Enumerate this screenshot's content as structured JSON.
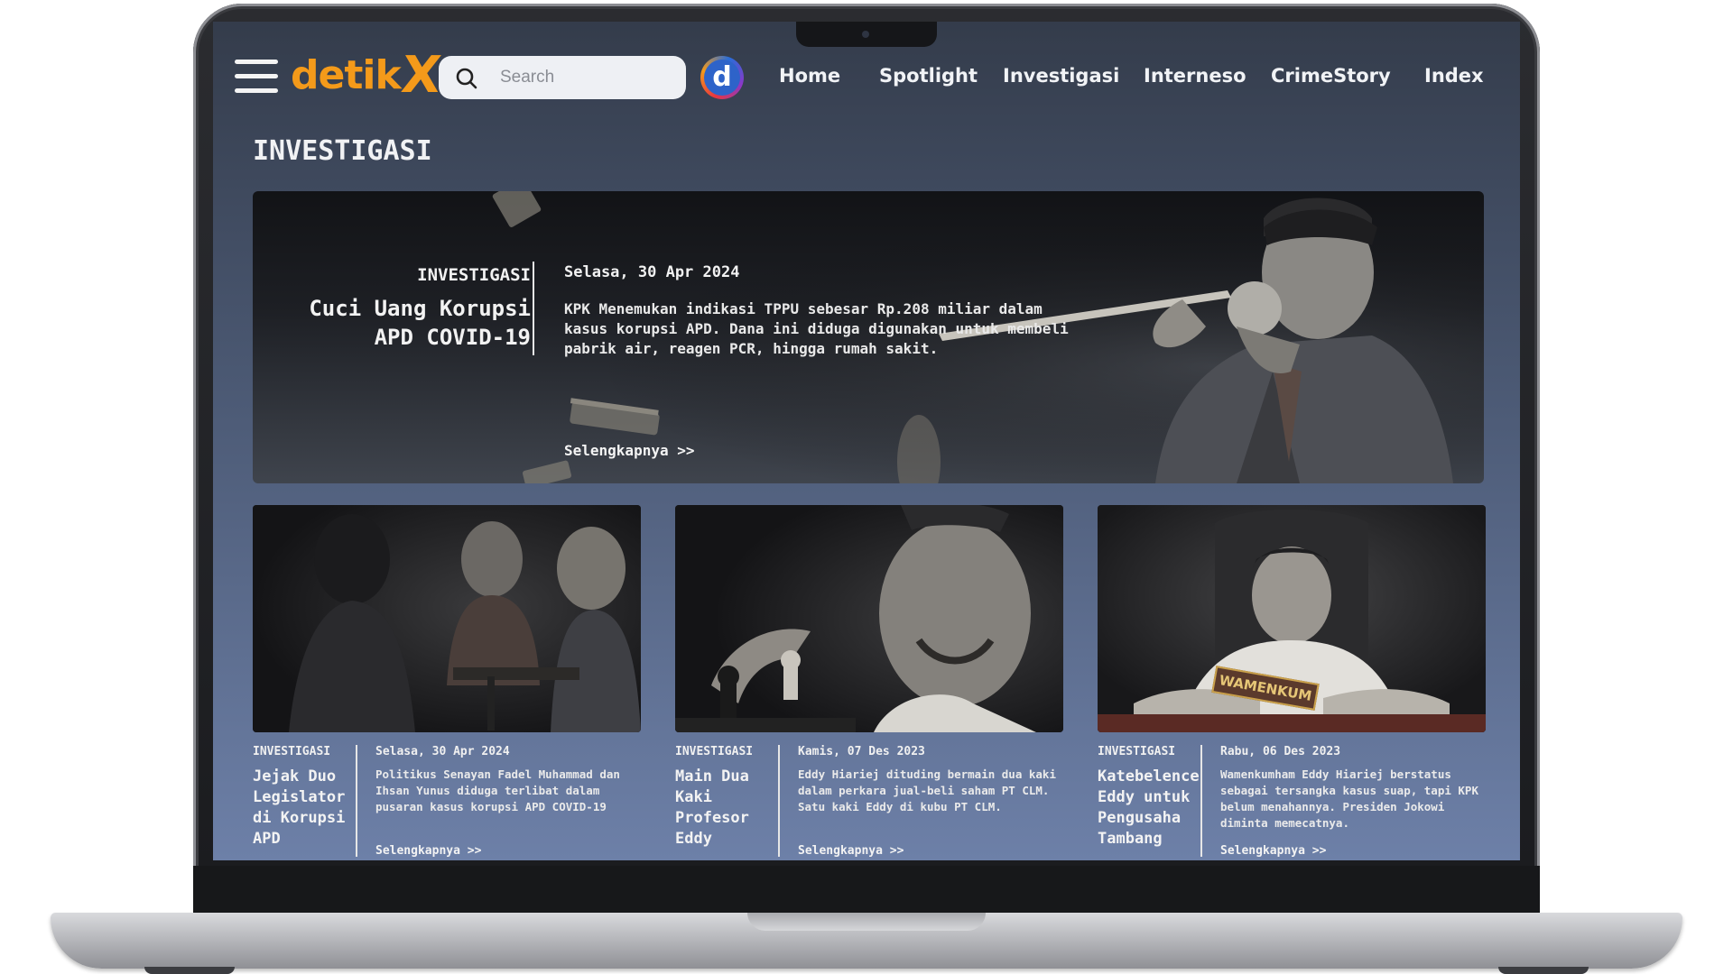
{
  "nav": {
    "logo_text": "detik",
    "logo_x": "X",
    "search_placeholder": "Search",
    "d_logo": "d",
    "links": [
      "Home",
      "Spotlight",
      "Investigasi",
      "Interneso",
      "CrimeStory",
      "Index"
    ]
  },
  "section": {
    "title": "INVESTIGASI"
  },
  "hero": {
    "label": "INVESTIGASI",
    "title": "Cuci Uang Korupsi APD COVID-19",
    "date": "Selasa, 30 Apr 2024",
    "description": "KPK Menemukan indikasi TPPU sebesar Rp.208 miliar dalam kasus korupsi APD. Dana ini diduga digunakan untuk membeli pabrik air, reagen PCR, hingga rumah sakit.",
    "more": "Selengkapnya >>"
  },
  "cards": [
    {
      "label": "INVESTIGASI",
      "title": "Jejak Duo Legislator di Korupsi APD",
      "date": "Selasa, 30 Apr 2024",
      "description": "Politikus Senayan Fadel Muhammad dan Ihsan Yunus diduga terlibat dalam pusaran kasus korupsi APD COVID-19",
      "more": "Selengkapnya >>"
    },
    {
      "label": "INVESTIGASI",
      "title": "Main Dua Kaki Profesor Eddy",
      "date": "Kamis, 07 Des 2023",
      "description": "Eddy Hiariej dituding bermain dua kaki dalam perkara jual-beli saham PT CLM. Satu kaki Eddy di kubu PT CLM.",
      "more": "Selengkapnya >>"
    },
    {
      "label": "INVESTIGASI",
      "title": "Katebelence Eddy untuk Pengusaha Tambang",
      "date": "Rabu, 06 Des 2023",
      "description": "Wamenkumham Eddy Hiariej berstatus sebagai tersangka kasus suap, tapi KPK belum menahannya. Presiden Jokowi diminta memecatnya.",
      "more": "Selengkapnya >>",
      "nameplate": "WAMENKUM"
    }
  ],
  "colors": {
    "brand_orange": "#f49a1a",
    "screen_top": "#343c4b",
    "screen_bottom": "#6d80a8"
  },
  "icons": {
    "menu": "hamburger-menu-icon",
    "search": "search-icon",
    "brand": "detik-d-logo-icon"
  }
}
